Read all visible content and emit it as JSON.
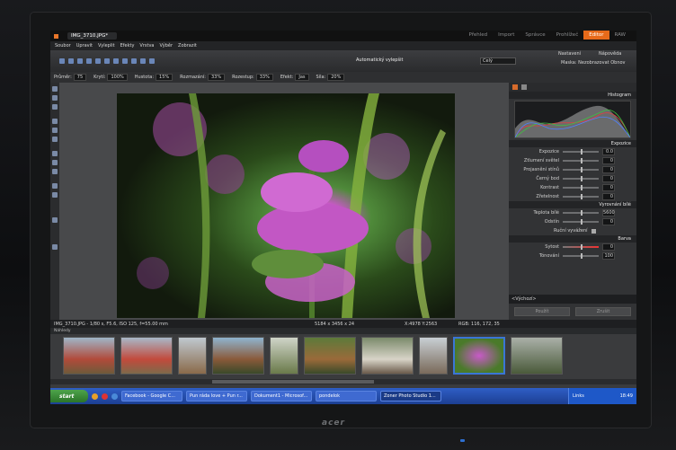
{
  "window": {
    "document_tab": "IMG_3710.JPG*"
  },
  "modes": [
    "Přehled",
    "Import",
    "Správce",
    "Prohlížeč",
    "Editor",
    "RAW"
  ],
  "active_mode": "Editor",
  "menu": [
    "Soubor",
    "Upravit",
    "Vyleplit",
    "Efekty",
    "Vrstva",
    "Výběr",
    "Zobrazit"
  ],
  "toolbar": {
    "auto_enhance": "Automatický vylepšit",
    "zoom": "Celý",
    "mask_label": "Maska:",
    "mask_value": "Nezobrazovat",
    "settings": "Nastavení",
    "help": "Nápověda",
    "previous": "Obnov"
  },
  "options": {
    "diameter_label": "Průměr:",
    "diameter": "75",
    "coverage_label": "Krytí:",
    "coverage": "100%",
    "density_label": "Hustota:",
    "density": "15%",
    "blur_label": "Rozmazání:",
    "blur": "33%",
    "step_label": "Rozestup:",
    "step": "33%",
    "effect_label": "Efekt:",
    "effect": "Jas",
    "strength_label": "Síla:",
    "strength": "20%"
  },
  "panel": {
    "histogram_title": "Histogram",
    "exposure_title": "Expozice",
    "exposure_rows": [
      {
        "label": "Expozice",
        "value": "0.0"
      },
      {
        "label": "Ztlumení světel",
        "value": "0"
      },
      {
        "label": "Projasnění stínů",
        "value": "0"
      },
      {
        "label": "Černý bod",
        "value": "0"
      },
      {
        "label": "Kontrast",
        "value": "0"
      },
      {
        "label": "Zřetelnost",
        "value": "0"
      }
    ],
    "wb_title": "Vyrovnání bílé",
    "wb_rows": [
      {
        "label": "Teplota bílé",
        "value": "5600"
      },
      {
        "label": "Odstín",
        "value": "0"
      }
    ],
    "manual_wb": "Ruční vyvážení",
    "color_title": "Barva",
    "color_rows": [
      {
        "label": "Sytost",
        "value": "0"
      },
      {
        "label": "Tónování",
        "value": "100"
      }
    ],
    "preset": "<Výchozí>",
    "apply": "Použít",
    "cancel": "Zrušit"
  },
  "status": {
    "file_info": "IMG_3710.JPG - 1/80 s, F5.6, ISO 125, f=55.00 mm",
    "dimensions": "5184 x 3456 x 24",
    "coords": "X:4978 Y:2563",
    "rgb": "RGB: 116, 172, 35"
  },
  "thumbnails_label": "Náhledy",
  "taskbar": {
    "start": "start",
    "tasks": [
      "Facebook - Google C...",
      "Pun ráda love + Pun r...",
      "Dokument1 - Microsof...",
      "pondelok",
      "Zoner Photo Studio 1..."
    ],
    "language": "Links",
    "clock": "18:49"
  },
  "brand": "acer",
  "colors": {
    "accent": "#e76a1a",
    "selection": "#3a76d6",
    "taskbar": "#2a56c0"
  }
}
